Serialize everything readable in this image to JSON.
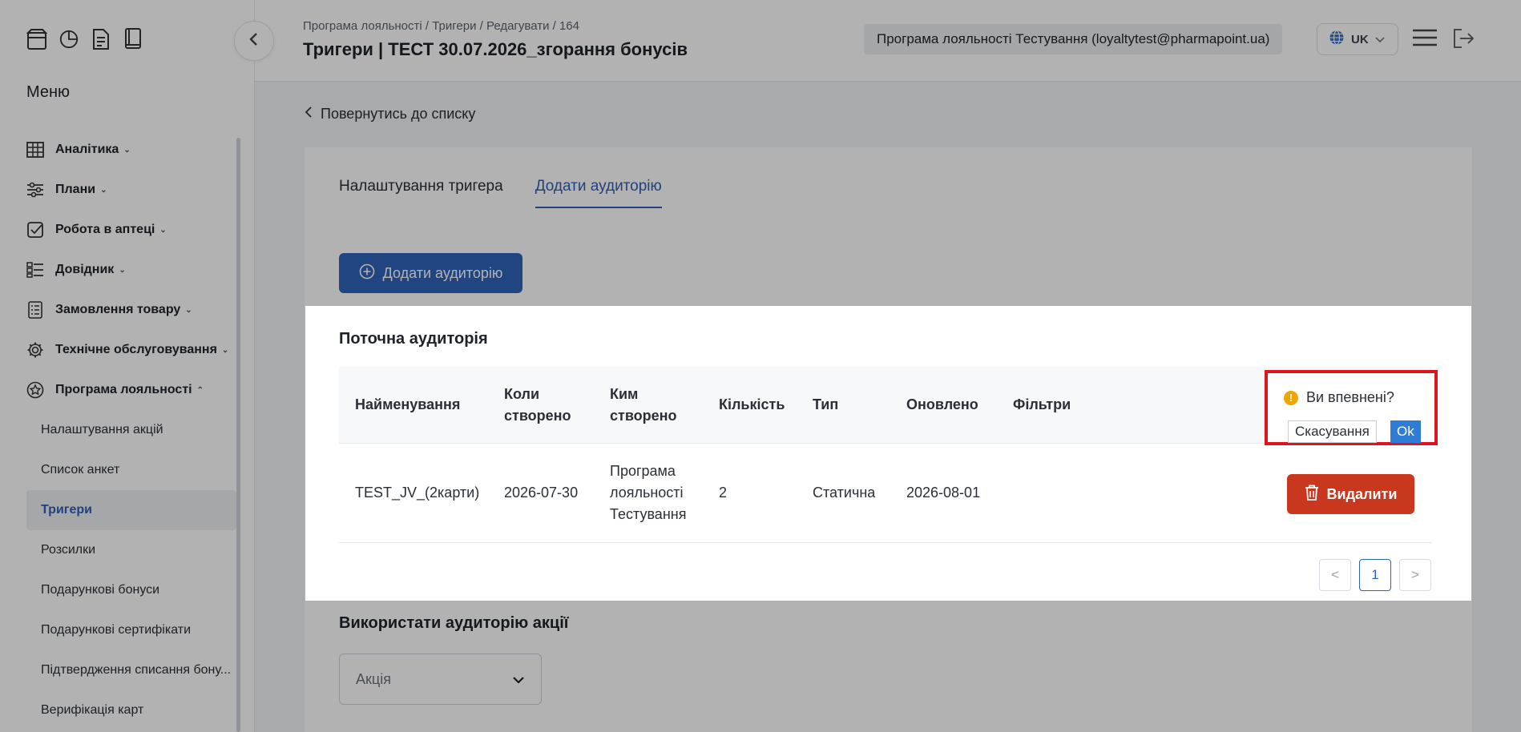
{
  "sidebar": {
    "menu_title": "Меню",
    "items": [
      {
        "label": "Аналітика",
        "icon": "table-icon",
        "chevron": "⌄"
      },
      {
        "label": "Плани",
        "icon": "sliders-icon",
        "chevron": "⌄"
      },
      {
        "label": "Робота в аптеці",
        "icon": "checkbox-icon",
        "chevron": "⌄"
      },
      {
        "label": "Довідник",
        "icon": "list-icon",
        "chevron": "⌄"
      },
      {
        "label": "Замовлення товару",
        "icon": "order-icon",
        "chevron": "⌄"
      },
      {
        "label": "Технічне обслуговування",
        "icon": "gear-icon",
        "chevron": "⌄"
      },
      {
        "label": "Програма лояльності",
        "icon": "star-icon",
        "chevron": "⌃"
      }
    ],
    "sub_items": [
      {
        "label": "Налаштування акцій"
      },
      {
        "label": "Список анкет"
      },
      {
        "label": "Тригери"
      },
      {
        "label": "Розсилки"
      },
      {
        "label": "Подарункові бонуси"
      },
      {
        "label": "Подарункові сертифікати"
      },
      {
        "label": "Підтвердження списання бону..."
      },
      {
        "label": "Верифікація карт"
      }
    ]
  },
  "header": {
    "breadcrumb": "Програма лояльності / Тригери / Редагувати / 164",
    "title": "Тригери | ТЕСТ 30.07.2026_згорання бонусів",
    "program": "Програма лояльності Тестування (loyaltytest@pharmapoint.ua)",
    "language": "UK"
  },
  "main": {
    "back_link": "Повернутись до списку",
    "tabs": [
      {
        "label": "Налаштування тригера"
      },
      {
        "label": "Додати аудиторію"
      }
    ],
    "add_audience_button": "Додати аудиторію",
    "current_audience": {
      "title": "Поточна аудиторія",
      "columns": [
        "Найменування",
        "Коли створено",
        "Ким створено",
        "Кількість",
        "Тип",
        "Оновлено",
        "Фільтри"
      ],
      "rows": [
        {
          "name": "TEST_JV_(2карти)",
          "created_at": "2026-07-30",
          "created_by": "Програма лояльності Тестування",
          "count": "2",
          "type": "Статична",
          "updated": "2026-08-01",
          "filters": ""
        }
      ],
      "delete_button": "Видалити",
      "pager": {
        "prev": "<",
        "page": "1",
        "next": ">"
      }
    },
    "use_audience": {
      "title": "Використати аудиторію акції",
      "select_placeholder": "Акція"
    }
  },
  "popconfirm": {
    "message": "Ви впевнені?",
    "cancel": "Скасування",
    "ok": "Ok"
  },
  "colors": {
    "primary": "#2f63b8",
    "danger": "#c9381e",
    "highlight": "#e0141e",
    "warning": "#f0a500"
  }
}
